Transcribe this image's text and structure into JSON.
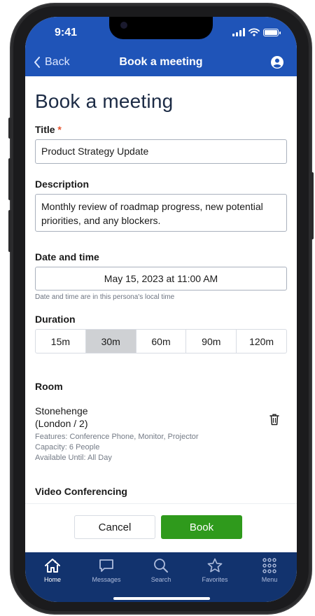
{
  "status_bar": {
    "time": "9:41"
  },
  "nav": {
    "back_label": "Back",
    "title": "Book a meeting",
    "profile_icon": "profile-icon"
  },
  "page": {
    "heading": "Book a meeting"
  },
  "form": {
    "title_label": "Title",
    "title_required_mark": "*",
    "title_value": "Product Strategy Update",
    "description_label": "Description",
    "description_value": "Monthly review of roadmap progress, new potential priorities, and any blockers.",
    "datetime_label": "Date and time",
    "datetime_value": "May 15, 2023 at 11:00 AM",
    "datetime_hint": "Date and time are in this persona's local time",
    "duration_label": "Duration",
    "duration_options": [
      "15m",
      "30m",
      "60m",
      "90m",
      "120m"
    ],
    "duration_selected": "30m"
  },
  "room": {
    "section_label": "Room",
    "name_line1": "Stonehenge",
    "name_line2": "(London / 2)",
    "features": "Features: Conference Phone, Monitor, Projector",
    "capacity": "Capacity: 6 People",
    "available": "Available Until: All Day"
  },
  "video": {
    "section_label": "Video Conferencing"
  },
  "actions": {
    "cancel_label": "Cancel",
    "book_label": "Book"
  },
  "tabbar": {
    "items": [
      {
        "label": "Home",
        "icon": "home-icon",
        "active": true
      },
      {
        "label": "Messages",
        "icon": "messages-icon",
        "active": false
      },
      {
        "label": "Search",
        "icon": "search-icon",
        "active": false
      },
      {
        "label": "Favorites",
        "icon": "star-icon",
        "active": false
      },
      {
        "label": "Menu",
        "icon": "grid-menu-icon",
        "active": false
      }
    ]
  },
  "colors": {
    "header_blue": "#1f54b8",
    "tabbar_navy": "#12336e",
    "book_green": "#2f9a1c",
    "required_red": "#e5522d",
    "selected_segment": "#cfd1d4"
  }
}
